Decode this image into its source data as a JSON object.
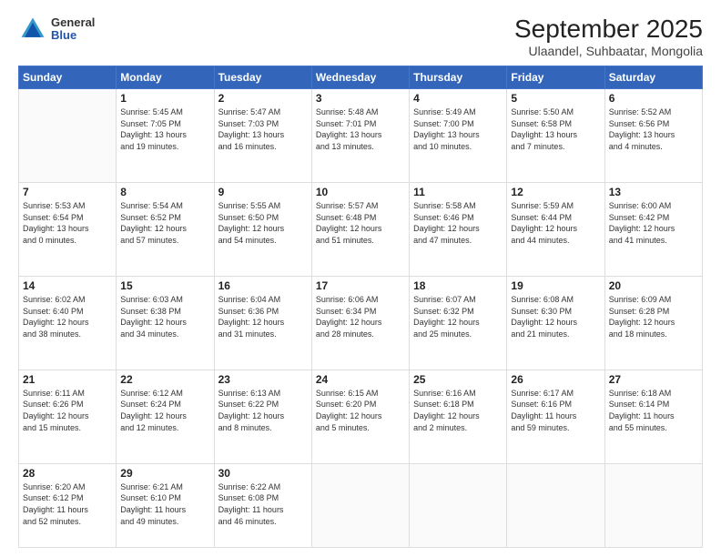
{
  "logo": {
    "line1": "General",
    "line2": "Blue"
  },
  "title": "September 2025",
  "subtitle": "Ulaandel, Suhbaatar, Mongolia",
  "days_of_week": [
    "Sunday",
    "Monday",
    "Tuesday",
    "Wednesday",
    "Thursday",
    "Friday",
    "Saturday"
  ],
  "weeks": [
    [
      {
        "day": "",
        "info": ""
      },
      {
        "day": "1",
        "info": "Sunrise: 5:45 AM\nSunset: 7:05 PM\nDaylight: 13 hours\nand 19 minutes."
      },
      {
        "day": "2",
        "info": "Sunrise: 5:47 AM\nSunset: 7:03 PM\nDaylight: 13 hours\nand 16 minutes."
      },
      {
        "day": "3",
        "info": "Sunrise: 5:48 AM\nSunset: 7:01 PM\nDaylight: 13 hours\nand 13 minutes."
      },
      {
        "day": "4",
        "info": "Sunrise: 5:49 AM\nSunset: 7:00 PM\nDaylight: 13 hours\nand 10 minutes."
      },
      {
        "day": "5",
        "info": "Sunrise: 5:50 AM\nSunset: 6:58 PM\nDaylight: 13 hours\nand 7 minutes."
      },
      {
        "day": "6",
        "info": "Sunrise: 5:52 AM\nSunset: 6:56 PM\nDaylight: 13 hours\nand 4 minutes."
      }
    ],
    [
      {
        "day": "7",
        "info": "Sunrise: 5:53 AM\nSunset: 6:54 PM\nDaylight: 13 hours\nand 0 minutes."
      },
      {
        "day": "8",
        "info": "Sunrise: 5:54 AM\nSunset: 6:52 PM\nDaylight: 12 hours\nand 57 minutes."
      },
      {
        "day": "9",
        "info": "Sunrise: 5:55 AM\nSunset: 6:50 PM\nDaylight: 12 hours\nand 54 minutes."
      },
      {
        "day": "10",
        "info": "Sunrise: 5:57 AM\nSunset: 6:48 PM\nDaylight: 12 hours\nand 51 minutes."
      },
      {
        "day": "11",
        "info": "Sunrise: 5:58 AM\nSunset: 6:46 PM\nDaylight: 12 hours\nand 47 minutes."
      },
      {
        "day": "12",
        "info": "Sunrise: 5:59 AM\nSunset: 6:44 PM\nDaylight: 12 hours\nand 44 minutes."
      },
      {
        "day": "13",
        "info": "Sunrise: 6:00 AM\nSunset: 6:42 PM\nDaylight: 12 hours\nand 41 minutes."
      }
    ],
    [
      {
        "day": "14",
        "info": "Sunrise: 6:02 AM\nSunset: 6:40 PM\nDaylight: 12 hours\nand 38 minutes."
      },
      {
        "day": "15",
        "info": "Sunrise: 6:03 AM\nSunset: 6:38 PM\nDaylight: 12 hours\nand 34 minutes."
      },
      {
        "day": "16",
        "info": "Sunrise: 6:04 AM\nSunset: 6:36 PM\nDaylight: 12 hours\nand 31 minutes."
      },
      {
        "day": "17",
        "info": "Sunrise: 6:06 AM\nSunset: 6:34 PM\nDaylight: 12 hours\nand 28 minutes."
      },
      {
        "day": "18",
        "info": "Sunrise: 6:07 AM\nSunset: 6:32 PM\nDaylight: 12 hours\nand 25 minutes."
      },
      {
        "day": "19",
        "info": "Sunrise: 6:08 AM\nSunset: 6:30 PM\nDaylight: 12 hours\nand 21 minutes."
      },
      {
        "day": "20",
        "info": "Sunrise: 6:09 AM\nSunset: 6:28 PM\nDaylight: 12 hours\nand 18 minutes."
      }
    ],
    [
      {
        "day": "21",
        "info": "Sunrise: 6:11 AM\nSunset: 6:26 PM\nDaylight: 12 hours\nand 15 minutes."
      },
      {
        "day": "22",
        "info": "Sunrise: 6:12 AM\nSunset: 6:24 PM\nDaylight: 12 hours\nand 12 minutes."
      },
      {
        "day": "23",
        "info": "Sunrise: 6:13 AM\nSunset: 6:22 PM\nDaylight: 12 hours\nand 8 minutes."
      },
      {
        "day": "24",
        "info": "Sunrise: 6:15 AM\nSunset: 6:20 PM\nDaylight: 12 hours\nand 5 minutes."
      },
      {
        "day": "25",
        "info": "Sunrise: 6:16 AM\nSunset: 6:18 PM\nDaylight: 12 hours\nand 2 minutes."
      },
      {
        "day": "26",
        "info": "Sunrise: 6:17 AM\nSunset: 6:16 PM\nDaylight: 11 hours\nand 59 minutes."
      },
      {
        "day": "27",
        "info": "Sunrise: 6:18 AM\nSunset: 6:14 PM\nDaylight: 11 hours\nand 55 minutes."
      }
    ],
    [
      {
        "day": "28",
        "info": "Sunrise: 6:20 AM\nSunset: 6:12 PM\nDaylight: 11 hours\nand 52 minutes."
      },
      {
        "day": "29",
        "info": "Sunrise: 6:21 AM\nSunset: 6:10 PM\nDaylight: 11 hours\nand 49 minutes."
      },
      {
        "day": "30",
        "info": "Sunrise: 6:22 AM\nSunset: 6:08 PM\nDaylight: 11 hours\nand 46 minutes."
      },
      {
        "day": "",
        "info": ""
      },
      {
        "day": "",
        "info": ""
      },
      {
        "day": "",
        "info": ""
      },
      {
        "day": "",
        "info": ""
      }
    ]
  ]
}
